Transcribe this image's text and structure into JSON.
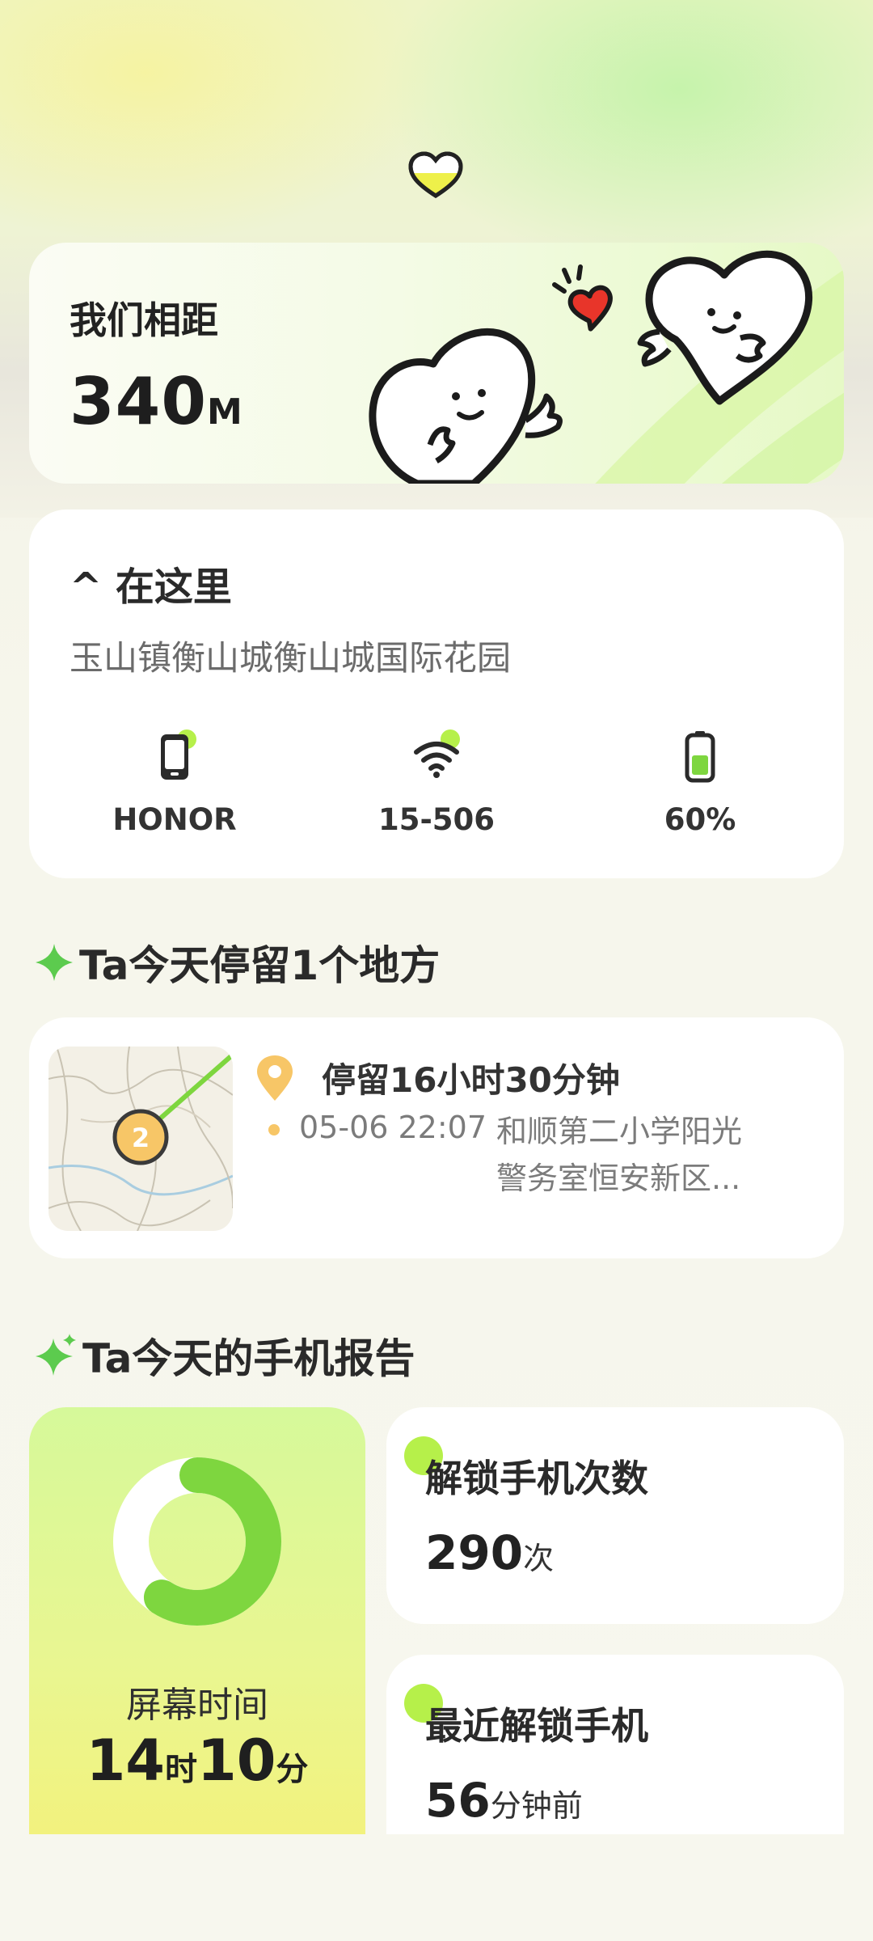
{
  "distance": {
    "label": "我们相距",
    "value": "340",
    "unit": "M"
  },
  "location": {
    "title": "^ 在这里",
    "address": "玉山镇衡山城衡山城国际花园",
    "device": "HONOR",
    "wifi": "15-506",
    "battery": "60%"
  },
  "stay_section": {
    "title": "Ta今天停留1个地方",
    "duration": "停留16小时30分钟",
    "time": "05-06 22:07",
    "place_line1": "和顺第二小学阳光",
    "place_line2": "警务室恒安新区...",
    "map_marker": "2"
  },
  "report_section": {
    "title": "Ta今天的手机报告",
    "screen_label": "屏幕时间",
    "screen_hours": "14",
    "hours_unit": "时",
    "screen_minutes": "10",
    "minutes_unit": "分",
    "screen_fraction": 0.59,
    "unlock_title": "解锁手机次数",
    "unlock_value": "290",
    "unlock_unit": "次",
    "recent_title": "最近解锁手机",
    "recent_value": "56",
    "recent_unit": "分钟前"
  },
  "colors": {
    "accent_green": "#7ed63f",
    "light_green": "#b6f04a",
    "marker_orange": "#f7c667"
  }
}
